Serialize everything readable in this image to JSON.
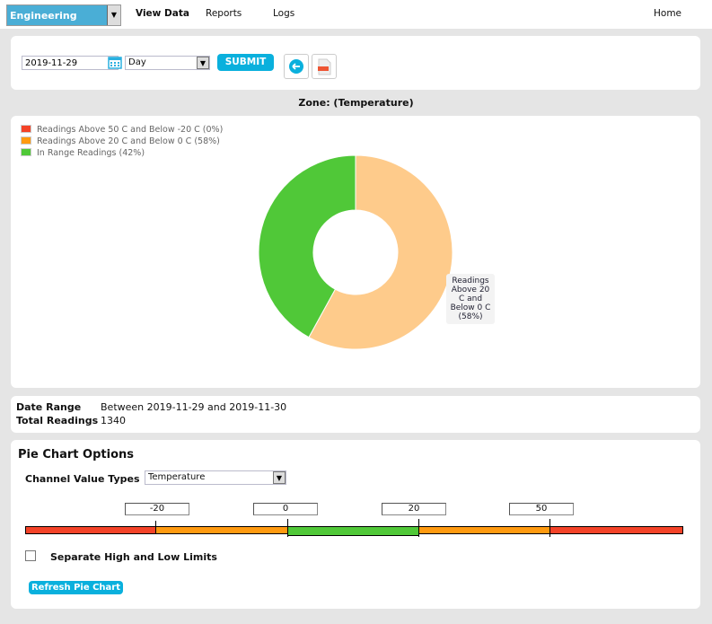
{
  "nav": {
    "department": "Engineering",
    "links": [
      "View Data",
      "Reports",
      "Logs"
    ],
    "home": "Home"
  },
  "toolbar": {
    "date": "2019-11-29",
    "period": "Day",
    "submit": "SUBMIT",
    "icons": [
      "calendar-icon",
      "back-arrow-icon",
      "pdf-icon"
    ]
  },
  "zone_title": "Zone: (Temperature)",
  "chart_data": {
    "type": "pie",
    "donut": true,
    "legend": [
      {
        "label": "Readings Above 50 C and Below -20 C (0%)",
        "color": "#f44328"
      },
      {
        "label": "Readings Above 20 C and Below 0 C (58%)",
        "color": "#ff9a10"
      },
      {
        "label": "In Range Readings (42%)",
        "color": "#50c838"
      }
    ],
    "slices": [
      {
        "value": 0,
        "color": "#f44328"
      },
      {
        "value": 58,
        "color": "#fecb8b"
      },
      {
        "value": 42,
        "color": "#50c838"
      }
    ],
    "tooltip": "Readings Above 20 C and Below 0 C (58%)"
  },
  "summary": {
    "date_range_label": "Date Range",
    "date_range": "Between 2019-11-29 and 2019-11-30",
    "total_label": "Total Readings",
    "total": "1340"
  },
  "options": {
    "title": "Pie Chart Options",
    "channel_label": "Channel Value Types",
    "channel": "Temperature",
    "thresholds": [
      "-20",
      "0",
      "20",
      "50"
    ],
    "colors": {
      "out": "#f44328",
      "warn": "#ff9a10",
      "ok": "#50c838"
    },
    "separate_label": "Separate High and Low Limits",
    "separate_checked": false,
    "refresh": "Refresh Pie Chart"
  }
}
